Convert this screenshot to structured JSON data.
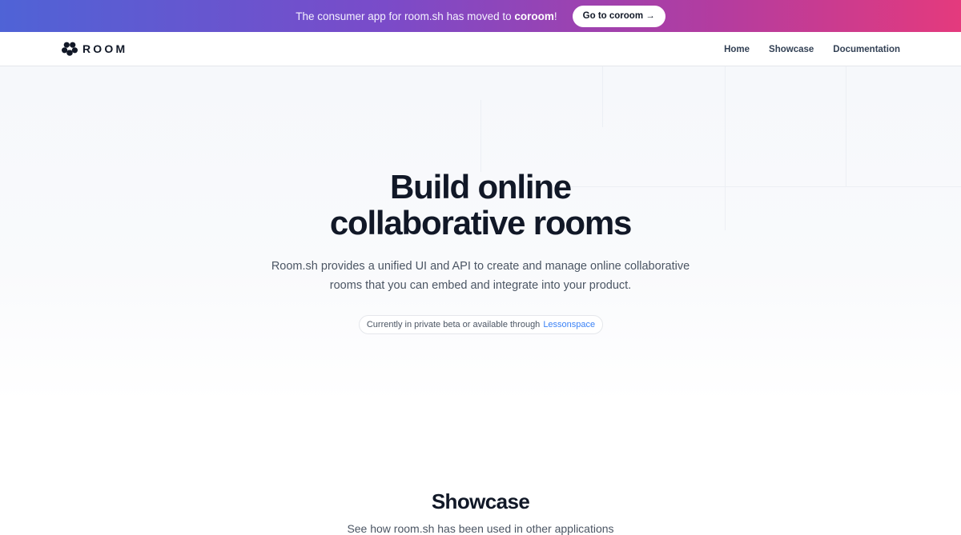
{
  "banner": {
    "text_prefix": "The consumer app for room.sh has moved to",
    "text_brand": "coroom",
    "text_suffix": "!",
    "button_label": "Go to coroom →"
  },
  "nav": {
    "logo_text": "ROOM",
    "links": [
      {
        "label": "Home"
      },
      {
        "label": "Showcase"
      },
      {
        "label": "Documentation"
      }
    ]
  },
  "hero": {
    "title_line1": "Build online",
    "title_line2": "collaborative rooms",
    "subtitle_line1": "Room.sh provides a unified UI and API to create and manage online collaborative",
    "subtitle_line2": "rooms that you can embed and integrate into your product.",
    "beta_text": "Currently in private beta or available through",
    "beta_link": "Lessonspace"
  },
  "showcase": {
    "title": "Showcase",
    "subtitle": "See how room.sh has been used in other applications"
  },
  "colors": {
    "banner_gradient_start": "#4f63d6",
    "banner_gradient_end": "#e43a7d",
    "link": "#3b82f6",
    "heading": "#111827"
  }
}
